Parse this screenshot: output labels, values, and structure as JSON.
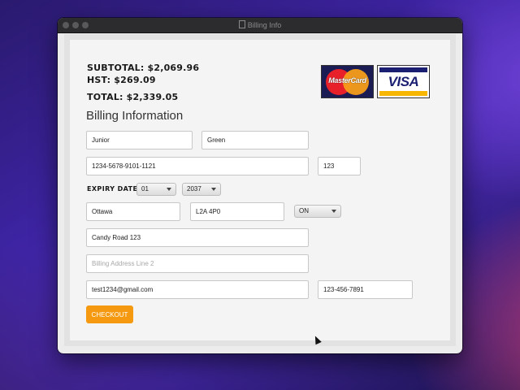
{
  "window": {
    "title": "Billing Info"
  },
  "totals": {
    "subtotal": "SUBTOTAL: $2,069.96",
    "hst": "HST: $269.09",
    "total": "TOTAL: $2,339.05"
  },
  "cards": {
    "mastercard": "MasterCard",
    "visa": "VISA"
  },
  "section_title": "Billing Information",
  "form": {
    "first_name": "Junior",
    "last_name": "Green",
    "card_number": "1234-5678-9101-1121",
    "cvv": "123",
    "expiry_label": "EXPIRY DATE:",
    "expiry_month": "01",
    "expiry_year": "2037",
    "city": "Ottawa",
    "postal_code": "L2A 4P0",
    "province": "ON",
    "address_line1": "Candy Road 123",
    "address_line2_placeholder": "Billing Address Line 2",
    "email": "test1234@gmail.com",
    "phone": "123-456-7891"
  },
  "checkout_label": "CHECKOUT",
  "colors": {
    "accent": "#f59a10"
  }
}
